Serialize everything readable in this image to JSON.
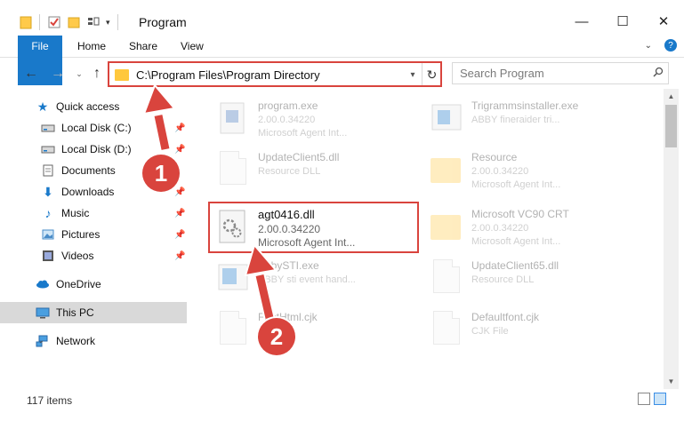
{
  "window": {
    "title": "Program",
    "controls": {
      "minimize": "—",
      "maximize": "☐",
      "close": "✕"
    }
  },
  "ribbon": {
    "tabs": [
      "File",
      "Home",
      "Share",
      "View"
    ]
  },
  "address": {
    "path": "C:\\Program Files\\Program Directory"
  },
  "search": {
    "placeholder": "Search Program"
  },
  "sidebar": {
    "items": [
      {
        "label": "Quick access",
        "icon": "star-icon",
        "pinned": false
      },
      {
        "label": "Local Disk (C:)",
        "icon": "drive-icon",
        "pinned": true
      },
      {
        "label": "Local Disk (D:)",
        "icon": "drive-icon",
        "pinned": true
      },
      {
        "label": "Documents",
        "icon": "document-icon",
        "pinned": false
      },
      {
        "label": "Downloads",
        "icon": "download-icon",
        "pinned": true
      },
      {
        "label": "Music",
        "icon": "music-icon",
        "pinned": true
      },
      {
        "label": "Pictures",
        "icon": "picture-icon",
        "pinned": true
      },
      {
        "label": "Videos",
        "icon": "video-icon",
        "pinned": true
      },
      {
        "label": "OneDrive",
        "icon": "cloud-icon",
        "pinned": false
      },
      {
        "label": "This PC",
        "icon": "computer-icon",
        "pinned": false,
        "selected": true
      },
      {
        "label": "Network",
        "icon": "network-icon",
        "pinned": false
      }
    ]
  },
  "files": [
    {
      "name": "program.exe",
      "line2": "2.00.0.34220",
      "line3": "Microsoft Agent Int...",
      "icon": "exe-icon"
    },
    {
      "name": "Trigrammsinstaller.exe",
      "line2": "ABBY fineraider tri...",
      "line3": "",
      "icon": "exe-icon"
    },
    {
      "name": "UpdateClient5.dll",
      "line2": "Resource DLL",
      "line3": "",
      "icon": "dll-icon"
    },
    {
      "name": "Resource",
      "line2": "2.00.0.34220",
      "line3": "Microsoft Agent Int...",
      "icon": "folder-icon"
    },
    {
      "name": "agt0416.dll",
      "line2": "2.00.0.34220",
      "line3": "Microsoft Agent Int...",
      "icon": "dll-icon"
    },
    {
      "name": "Microsoft VC90 CRT",
      "line2": "2.00.0.34220",
      "line3": "Microsoft Agent Int...",
      "icon": "folder-icon"
    },
    {
      "name": "AbbySTI.exe",
      "line2": "ABBY sti event hand...",
      "line3": "",
      "icon": "exe-icon"
    },
    {
      "name": "UpdateClient65.dll",
      "line2": "Resource DLL",
      "line3": "",
      "icon": "dll-icon"
    },
    {
      "name": "FontHtml.cjk",
      "line2": "",
      "line3": "",
      "icon": "file-icon"
    },
    {
      "name": "Defaultfont.cjk",
      "line2": "CJK File",
      "line3": "",
      "icon": "file-icon"
    }
  ],
  "status": {
    "item_count": "117 items"
  },
  "annotations": {
    "step1": "1",
    "step2": "2",
    "color": "#d9443d"
  }
}
